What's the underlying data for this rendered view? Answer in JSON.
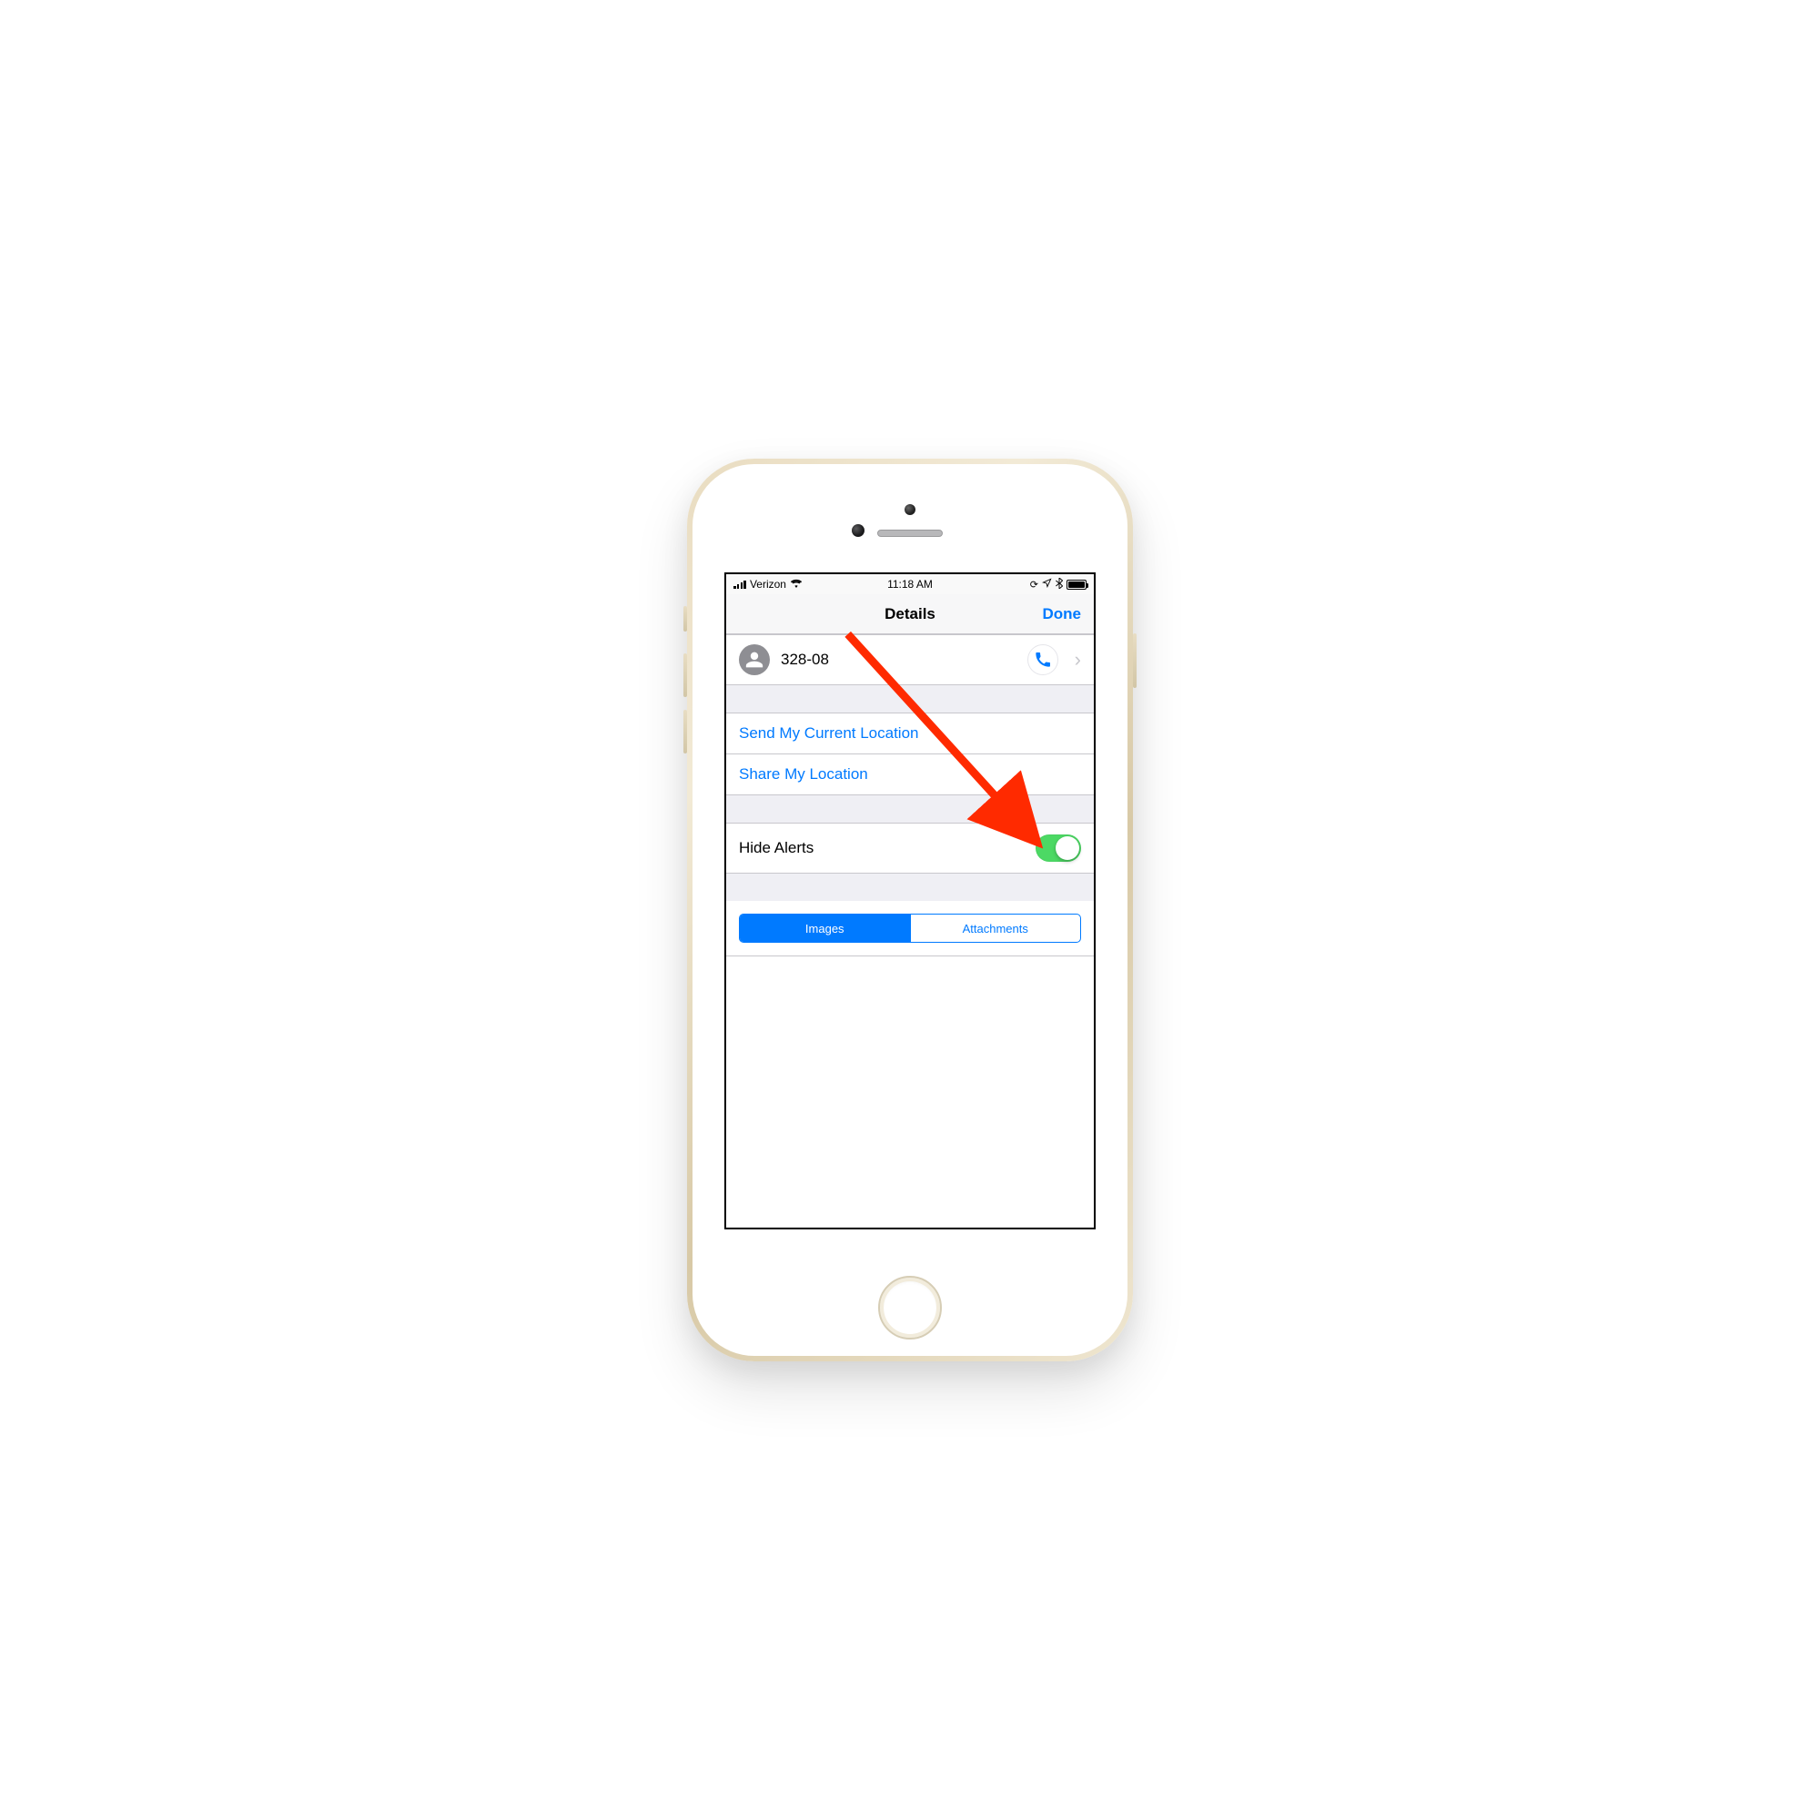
{
  "status": {
    "carrier": "Verizon",
    "time": "11:18 AM",
    "icons": {
      "rotation_lock": "⊕",
      "location": "➤",
      "bluetooth": "✱"
    }
  },
  "nav": {
    "title": "Details",
    "done": "Done"
  },
  "contact": {
    "display_number": "328-08"
  },
  "actions": {
    "send_location": "Send My Current Location",
    "share_location": "Share My Location"
  },
  "hide_alerts": {
    "label": "Hide Alerts",
    "on": true
  },
  "segmented": {
    "images": "Images",
    "attachments": "Attachments",
    "selected": "images"
  },
  "annotation": {
    "target": "hide-alerts-toggle",
    "color": "#ff2a00"
  }
}
